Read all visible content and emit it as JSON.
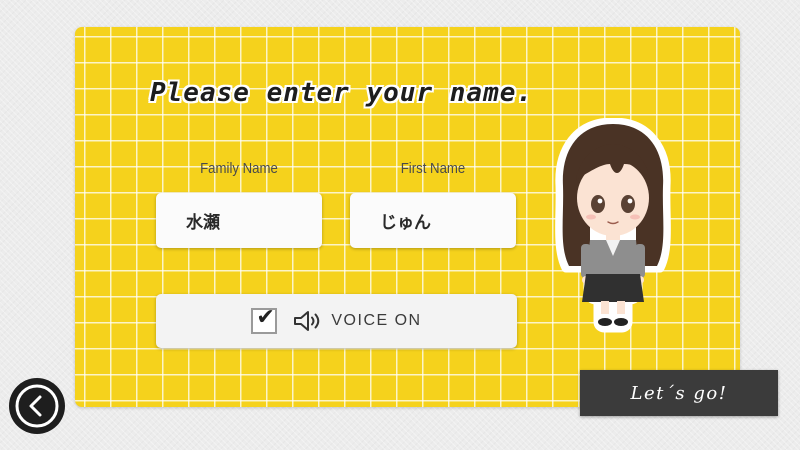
{
  "form": {
    "headline": "Please enter your name.",
    "family_name_label": "Family Name",
    "family_name_value": "水瀬",
    "first_name_label": "First Name",
    "first_name_value": "じゅん"
  },
  "voice": {
    "checked": true,
    "checkmark": "✔",
    "icon": "speaker-icon",
    "label": "VOICE ON"
  },
  "actions": {
    "go_label": "Let´s go!",
    "back_icon": "chevron-left-icon"
  },
  "colors": {
    "card_background": "#f5d21c",
    "button_dark": "#3b3b3b",
    "back_button": "#1e1e1e"
  }
}
